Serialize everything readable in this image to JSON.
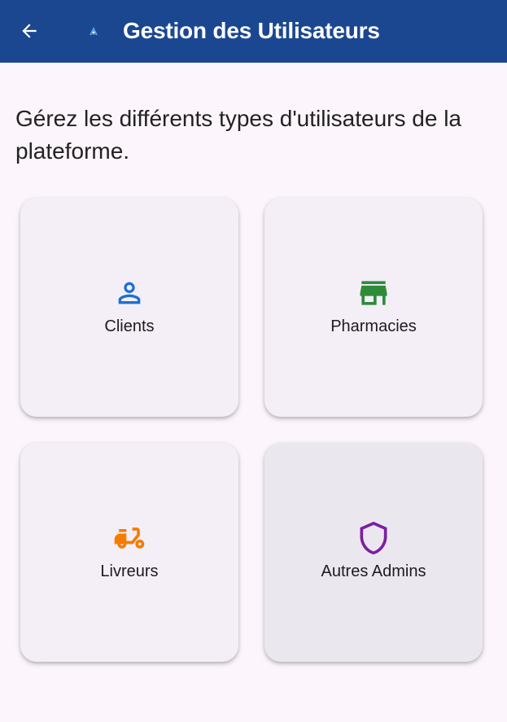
{
  "app_bar": {
    "title": "Gestion des Utilisateurs",
    "back_icon": "arrow-left-icon",
    "logo_icon": "app-logo-icon",
    "background": "#1b4791"
  },
  "intro_text": "Gérez les différents types d'utilisateurs de la plateforme.",
  "cards": [
    {
      "label": "Clients",
      "icon": "person-icon",
      "color": "#1e6fd6"
    },
    {
      "label": "Pharmacies",
      "icon": "store-icon",
      "color": "#2e8b3a"
    },
    {
      "label": "Livreurs",
      "icon": "moped-icon",
      "color": "#f57c00"
    },
    {
      "label": "Autres Admins",
      "icon": "shield-icon",
      "color": "#7b1fa2"
    }
  ]
}
